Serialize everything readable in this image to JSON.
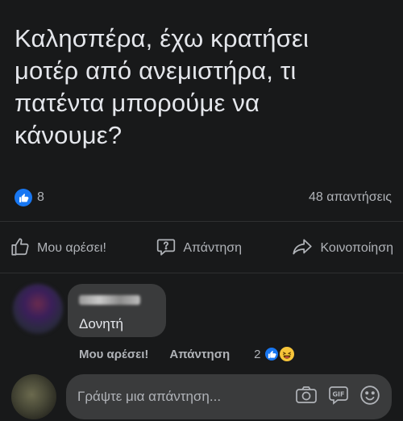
{
  "post": {
    "text": "Καλησπέρα, έχω κρατήσει\nμοτέρ από ανεμιστήρα, τι\nπατέντα μπορούμε να\nκάνουμε?"
  },
  "reactions": {
    "like_count": "8",
    "replies_count": "48 απαντήσεις"
  },
  "actions": {
    "like_label": "Μου αρέσει!",
    "reply_label": "Απάντηση",
    "share_label": "Κοινοποίηση"
  },
  "comment": {
    "text": "Δονητή",
    "like_label": "Μου αρέσει!",
    "reply_label": "Απάντηση",
    "reaction_count": "2"
  },
  "reply_box": {
    "placeholder": "Γράψτε μια απάντηση..."
  },
  "colors": {
    "background": "#18191a",
    "bubble": "#3a3b3c",
    "accent": "#1877f2",
    "text_primary": "#e4e6eb",
    "text_secondary": "#b0b3b8"
  }
}
